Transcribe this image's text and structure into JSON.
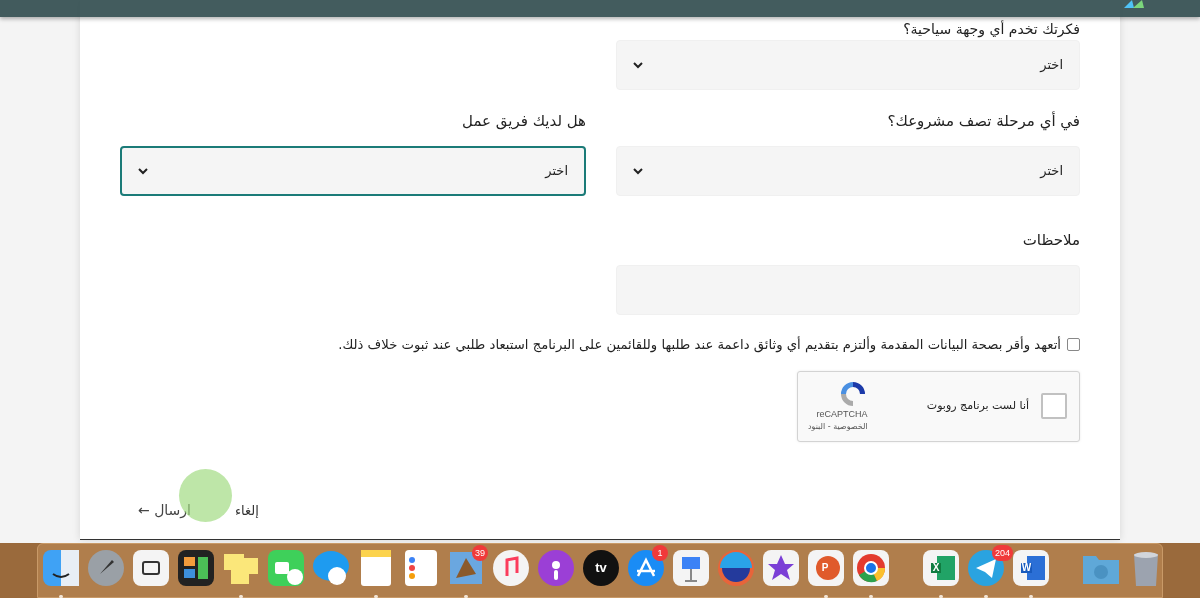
{
  "form": {
    "fields": [
      {
        "label": "فكرتك تخدم أي وجهة سياحية؟",
        "kind": "select",
        "value": "اختر",
        "focused": false
      },
      {
        "label": "في أي مرحلة تصف مشروعك؟",
        "kind": "select",
        "value": "اختر",
        "focused": false
      },
      {
        "label": "هل لديك فريق عمل",
        "kind": "select",
        "value": "اختر",
        "focused": true
      },
      {
        "label": "ملاحظات",
        "kind": "textarea",
        "focused": false
      }
    ],
    "pledge": {
      "text": "أتعهد وأقر بصحة البيانات المقدمة وألتزم بتقديم أي وثائق داعمة عند طلبها وللقائمين على البرنامج استبعاد طلبي عند ثبوت خلاف ذلك.",
      "checked": false
    },
    "captcha": {
      "label": "أنا لست برنامج روبوت",
      "brand": "reCAPTCHA",
      "links": "الخصوصية - البنود",
      "checked": false
    },
    "buttons": [
      {
        "kind": "cancel",
        "label": "إلغاء"
      },
      {
        "kind": "submit",
        "label": "ارسال ←"
      }
    ]
  },
  "dock": {
    "items": [
      {
        "kind": "trash",
        "running": false
      },
      {
        "kind": "downloads",
        "running": false
      },
      {
        "kind": "separator"
      },
      {
        "kind": "word",
        "running": true,
        "glyph": "W"
      },
      {
        "kind": "telegram",
        "running": true,
        "badge": "204"
      },
      {
        "kind": "excel",
        "running": true,
        "glyph": "X"
      },
      {
        "kind": "separator"
      },
      {
        "kind": "chrome",
        "running": true
      },
      {
        "kind": "powerpoint",
        "running": true,
        "glyph": "P"
      },
      {
        "kind": "imovie",
        "running": false
      },
      {
        "kind": "halfcircle",
        "running": false
      },
      {
        "kind": "keynote",
        "running": false
      },
      {
        "kind": "appstore",
        "running": false,
        "badge": "1"
      },
      {
        "kind": "tv",
        "running": false,
        "glyph": "tv"
      },
      {
        "kind": "podcasts",
        "running": false
      },
      {
        "kind": "music",
        "running": false
      },
      {
        "kind": "mail",
        "running": true,
        "badge": "39"
      },
      {
        "kind": "reminders",
        "running": false
      },
      {
        "kind": "notes",
        "running": true
      },
      {
        "kind": "messages",
        "running": false
      },
      {
        "kind": "facetime",
        "running": false
      },
      {
        "kind": "stickies",
        "running": true
      },
      {
        "kind": "mission",
        "running": false
      },
      {
        "kind": "screenshot",
        "running": false
      },
      {
        "kind": "launchpad",
        "running": false
      },
      {
        "kind": "finder",
        "running": true
      }
    ]
  }
}
